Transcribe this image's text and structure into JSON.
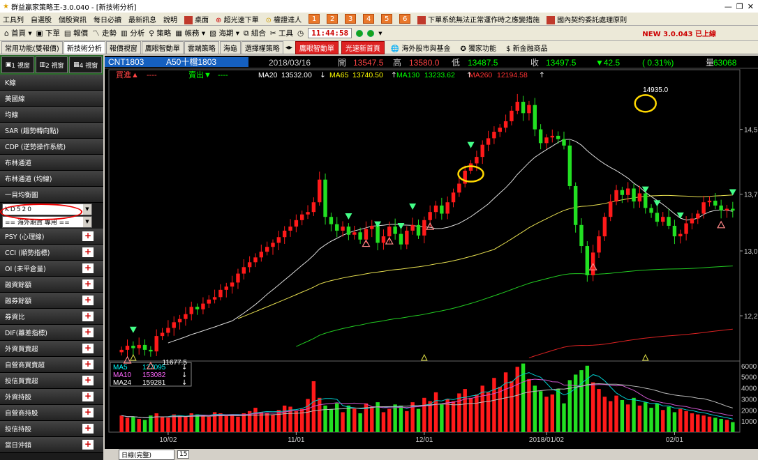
{
  "window": {
    "title": "群益贏家策略王-3.0.040 - [新技術分析]"
  },
  "menu": {
    "items": [
      "工具列",
      "自選股",
      "個股資訊",
      "每日必讀",
      "最新訊息",
      "說明",
      "桌面",
      "超光速下單",
      "權證達人"
    ],
    "numbers": [
      "1",
      "2",
      "3",
      "4",
      "5",
      "6"
    ],
    "notice1": "下單系統無法正常運作時之應變措施",
    "notice2": "國內契約委託處理原則"
  },
  "toolbar": {
    "items": [
      "首頁",
      "下單",
      "報價",
      "走勢",
      "分析",
      "策略",
      "帳務",
      "海期",
      "組合",
      "工具"
    ],
    "clock": "11:44:58",
    "new_version": "NEW 3.0.043 已上線"
  },
  "tabs": {
    "items": [
      "常用功能(雙報價)",
      "新技術分析",
      "報價視窗",
      "鷹眼智動單",
      "雲端策略",
      "海龜",
      "選擇權策略"
    ],
    "active": 1,
    "red1": "鷹眼智動單",
    "red2": "光速新首頁",
    "btn3": "海外股市與基金",
    "btn4": "獨家功能",
    "btn5": "新金融商品"
  },
  "sidebar": {
    "views": [
      "1\n視窗",
      "2\n視窗",
      "4\n視窗"
    ],
    "items": [
      "K線",
      "美國線",
      "均線",
      "SAR (趨勢轉向點)",
      "CDP (逆勢操作系統)",
      "布林通道",
      "布林通道 (均線)",
      "一目均衡圖"
    ],
    "kd_select": "KD520",
    "overseas_select": "== 海外期貨 專用 ==",
    "plus_items": [
      "PSY (心理線)",
      "CCI (順勢指標)",
      "OI (未平倉量)",
      "融資餘額",
      "融券餘額",
      "券資比",
      "DIF(離差指標)",
      "外資買賣超",
      "自營商買賣超",
      "投信買賣超",
      "外資持股",
      "自營商持股",
      "投信持股",
      "當日沖銷"
    ]
  },
  "quote": {
    "code": "CNT1803",
    "name": "A50十檔1803",
    "date": "2018/03/16",
    "open_label": "開",
    "open": "13547.5",
    "high_label": "高",
    "high": "13580.0",
    "low_label": "低",
    "low": "13487.5",
    "close_label": "收",
    "close": "13497.5",
    "change": "▼42.5",
    "pct": "( 0.31%)",
    "vol_label": "量",
    "vol": "63068"
  },
  "signals": {
    "buy": "買進▲",
    "buy_v": "----",
    "sell": "賣出▼",
    "sell_v": "----"
  },
  "ma": [
    {
      "label": "MA20",
      "value": "13532.00",
      "arrow": "↓",
      "color": "#ffffff"
    },
    {
      "label": "MA65",
      "value": "13740.50",
      "arrow": "↑",
      "color": "#ffff00"
    },
    {
      "label": "MA130",
      "value": "13233.62",
      "arrow": "↑",
      "color": "#00ff00"
    },
    {
      "label": "MA260",
      "value": "12194.58",
      "arrow": "↑",
      "color": "#ff3333"
    }
  ],
  "vol_ma": [
    {
      "label": "MA5",
      "value": "127095",
      "arrow": "↓",
      "color": "#00ffff"
    },
    {
      "label": "MA10",
      "value": "153082",
      "arrow": "↓",
      "color": "#ff66ff"
    },
    {
      "label": "MA24",
      "value": "159281",
      "arrow": "↓",
      "color": "#ffffff"
    }
  ],
  "bottombar": {
    "period": "日線(完整)",
    "count": "15"
  },
  "chart_data": {
    "type": "candlestick",
    "y_ticks": [
      "14,5",
      "13,7",
      "13,0",
      "12,2"
    ],
    "y_tick_values": [
      14500,
      13700,
      13000,
      12200
    ],
    "ylim": [
      11650,
      15150
    ],
    "vol_ticks": [
      "6000",
      "5000",
      "4000",
      "3000",
      "2000",
      "1000"
    ],
    "vol_tick_values": [
      6000,
      5000,
      4000,
      3000,
      2000,
      1000
    ],
    "vol_ylim": [
      0,
      6300
    ],
    "x_labels": [
      "10/02",
      "11/01",
      "12/01",
      "2018/01/02",
      "02/01",
      "03/01"
    ],
    "x_label_index": [
      8,
      30,
      52,
      73,
      95,
      117
    ],
    "high_label": "14935.0",
    "high_index": 91,
    "low_label": "11677.5",
    "low_index": 7,
    "close": [
      11780,
      11830,
      11800,
      11840,
      11780,
      11760,
      11950,
      11990,
      12050,
      12120,
      12160,
      12220,
      12310,
      12280,
      12350,
      12400,
      12430,
      12520,
      12560,
      12610,
      12720,
      12800,
      12860,
      12920,
      12990,
      13050,
      13100,
      13170,
      13250,
      13300,
      13380,
      13450,
      13480,
      13600,
      13880,
      13420,
      13330,
      13250,
      13300,
      13200,
      13230,
      13140,
      13270,
      13310,
      13100,
      13180,
      13300,
      13210,
      13080,
      13250,
      13320,
      13190,
      13380,
      13480,
      13560,
      13460,
      13600,
      13720,
      13830,
      13990,
      14080,
      14160,
      14310,
      14390,
      14470,
      14520,
      14600,
      14730,
      14840,
      14700,
      14800,
      14500,
      14330,
      14400,
      14420,
      14380,
      14300,
      13800,
      13320,
      13060,
      12700,
      12980,
      13180,
      13420,
      13610,
      13750,
      13690,
      13770,
      13610,
      13710,
      13530,
      13470,
      13360,
      13420,
      13310,
      13180,
      13210,
      13340,
      13400,
      13460,
      13600,
      13620,
      13560,
      13500,
      13520,
      13497
    ],
    "volume": [
      1500,
      1300,
      1400,
      1200,
      1100,
      1500,
      1700,
      1400,
      1300,
      1600,
      1500,
      1400,
      1700,
      1600,
      1500,
      1400,
      1800,
      1700,
      1500,
      1600,
      1400,
      1700,
      1900,
      2200,
      1800,
      1700,
      1600,
      2000,
      2400,
      2300,
      1900,
      2100,
      3000,
      4600,
      3100,
      2400,
      2100,
      2600,
      1800,
      2400,
      2100,
      1700,
      2600,
      2300,
      2700,
      1800,
      2100,
      2500,
      2400,
      1900,
      2700,
      2100,
      3100,
      2800,
      3600,
      2500,
      3000,
      2800,
      3500,
      3900,
      3100,
      3400,
      4200,
      3600,
      4900,
      4100,
      5400,
      4600,
      5900,
      6200,
      4800,
      4200,
      3700,
      3200,
      3400,
      3900,
      2600,
      4700,
      5200,
      5600,
      6000,
      4500,
      3900,
      3200,
      2800,
      3300,
      2900,
      2500,
      3100,
      2400,
      2700,
      2200,
      2600,
      2000,
      2300,
      1800,
      2100,
      1900,
      1700,
      1600,
      1500,
      1400,
      1300,
      1200,
      1100,
      900
    ]
  }
}
